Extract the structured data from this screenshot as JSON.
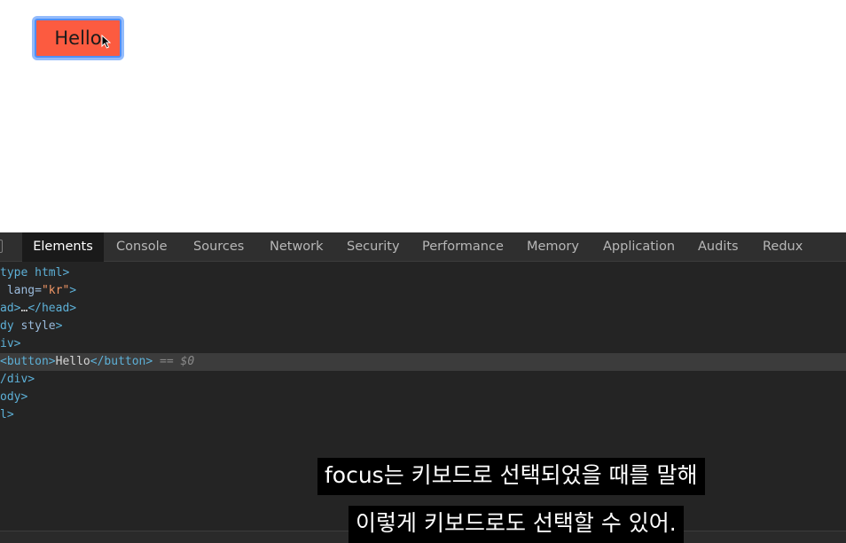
{
  "page": {
    "button_label": "Hello"
  },
  "devtools": {
    "tabs": [
      "Elements",
      "Console",
      "Sources",
      "Network",
      "Security",
      "Performance",
      "Memory",
      "Application",
      "Audits",
      "Redux"
    ],
    "active_tab": "Elements",
    "dom_lines": {
      "l1": "type html>",
      "l2_attr": "lang=",
      "l2_val": "\"kr\"",
      "l3": "ad>",
      "l3_ellipsis": "…",
      "l3_close": "</head>",
      "l4_tag": "dy",
      "l4_attr": "style",
      "l5": "iv>",
      "l6_open": "<button>",
      "l6_text": "Hello",
      "l6_close": "</button>",
      "l6_eq": "==",
      "l6_ref": "$0",
      "l7": "/div>",
      "l8": "ody>",
      "l9": "l>"
    }
  },
  "subtitles": {
    "line1": "focus는 키보드로 선택되었을 때를 말해",
    "line2": "이렇게 키보드로도 선택할 수 있어."
  },
  "colors": {
    "button_bg": "#fc5b40",
    "focus_ring": "#4f8ff7",
    "devtools_bg": "#242424",
    "tag": "#5db0d7",
    "attr_value": "#f29766"
  }
}
